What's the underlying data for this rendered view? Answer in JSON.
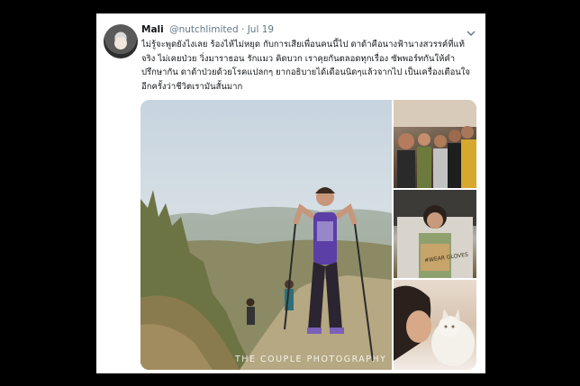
{
  "tweet": {
    "author_name": "Mali",
    "author_handle": "@nutchlimited",
    "separator": "·",
    "date": "Jul 19",
    "text_lines": [
      "ไม่รู้จะพูดยังไงเลย ร้องไห้ไม่หยุด กับการเสียเพื่อนคนนี้ไป ดาด้าคือนางฟ้านางสวรรค์ที่แท้",
      "จริง ไม่เคยป่วย วิ่งมาราธอน รักแมว คิดบวก เราคุยกันตลอดทุกเรื่อง ซัพพอร์ทกันให้คำ",
      "ปรึกษากัน ดาด้าป่วยด้วยโรคแปลกๆ ยากอธิบายได้เดือนนิดๆแล้วจากไป เป็นเครื่องเตือนใจ",
      "อีกครั้งว่าชีวิตเรามันสั้นมาก"
    ]
  },
  "media": {
    "watermark": "THE COUPLE PHOTOGRAPHY",
    "sign_text": "#WEAR GLOVES"
  },
  "icons": {
    "caret": "chevron-down-icon",
    "avatar": "profile-avatar"
  },
  "colors": {
    "background": "#000000",
    "card": "#ffffff",
    "text": "#14171a",
    "muted": "#657786"
  }
}
